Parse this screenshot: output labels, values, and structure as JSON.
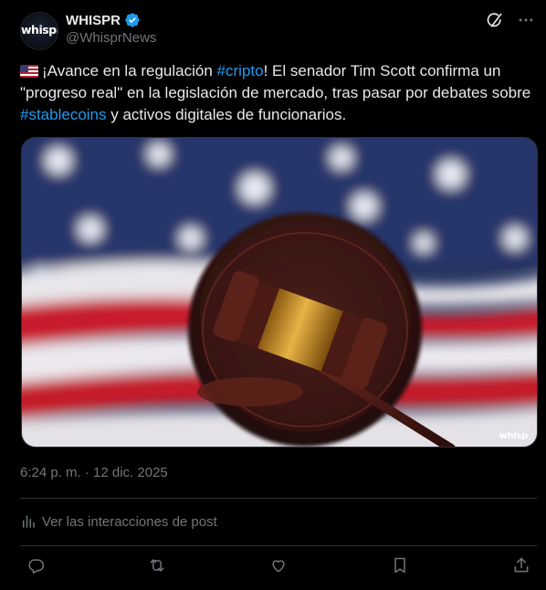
{
  "author": {
    "display_name": "WHISPR",
    "handle": "@WhisprNews",
    "avatar_logo": "whispr",
    "verified_icon": "verified-badge-icon",
    "verified_color": "#1d9bf0"
  },
  "top_actions": [
    "grok-icon",
    "more-icon"
  ],
  "tweet": {
    "flag_icon": "us-flag-emoji",
    "part1": "¡Avance en la regulación ",
    "hashtag1": "#cripto",
    "part2": "! El senador Tim Scott confirma un \"progreso real\" en la legislación de mercado, tras pasar por debates sobre ",
    "hashtag2": "#stablecoins",
    "part3": " y activos digitales de funcionarios.",
    "hashtag_color": "#1d9bf0"
  },
  "media": {
    "watermark": "whisp"
  },
  "timestamp": "6:24 p. m. · 12 dic. 2025",
  "engagement_link": "Ver las interacciones de post",
  "actions": [
    "reply-icon",
    "retweet-icon",
    "like-icon",
    "bookmark-icon",
    "share-icon"
  ],
  "colors": {
    "background": "#000000",
    "text": "#e7e9ea",
    "muted": "#71767b",
    "border": "#2f3336",
    "accent": "#1d9bf0"
  }
}
